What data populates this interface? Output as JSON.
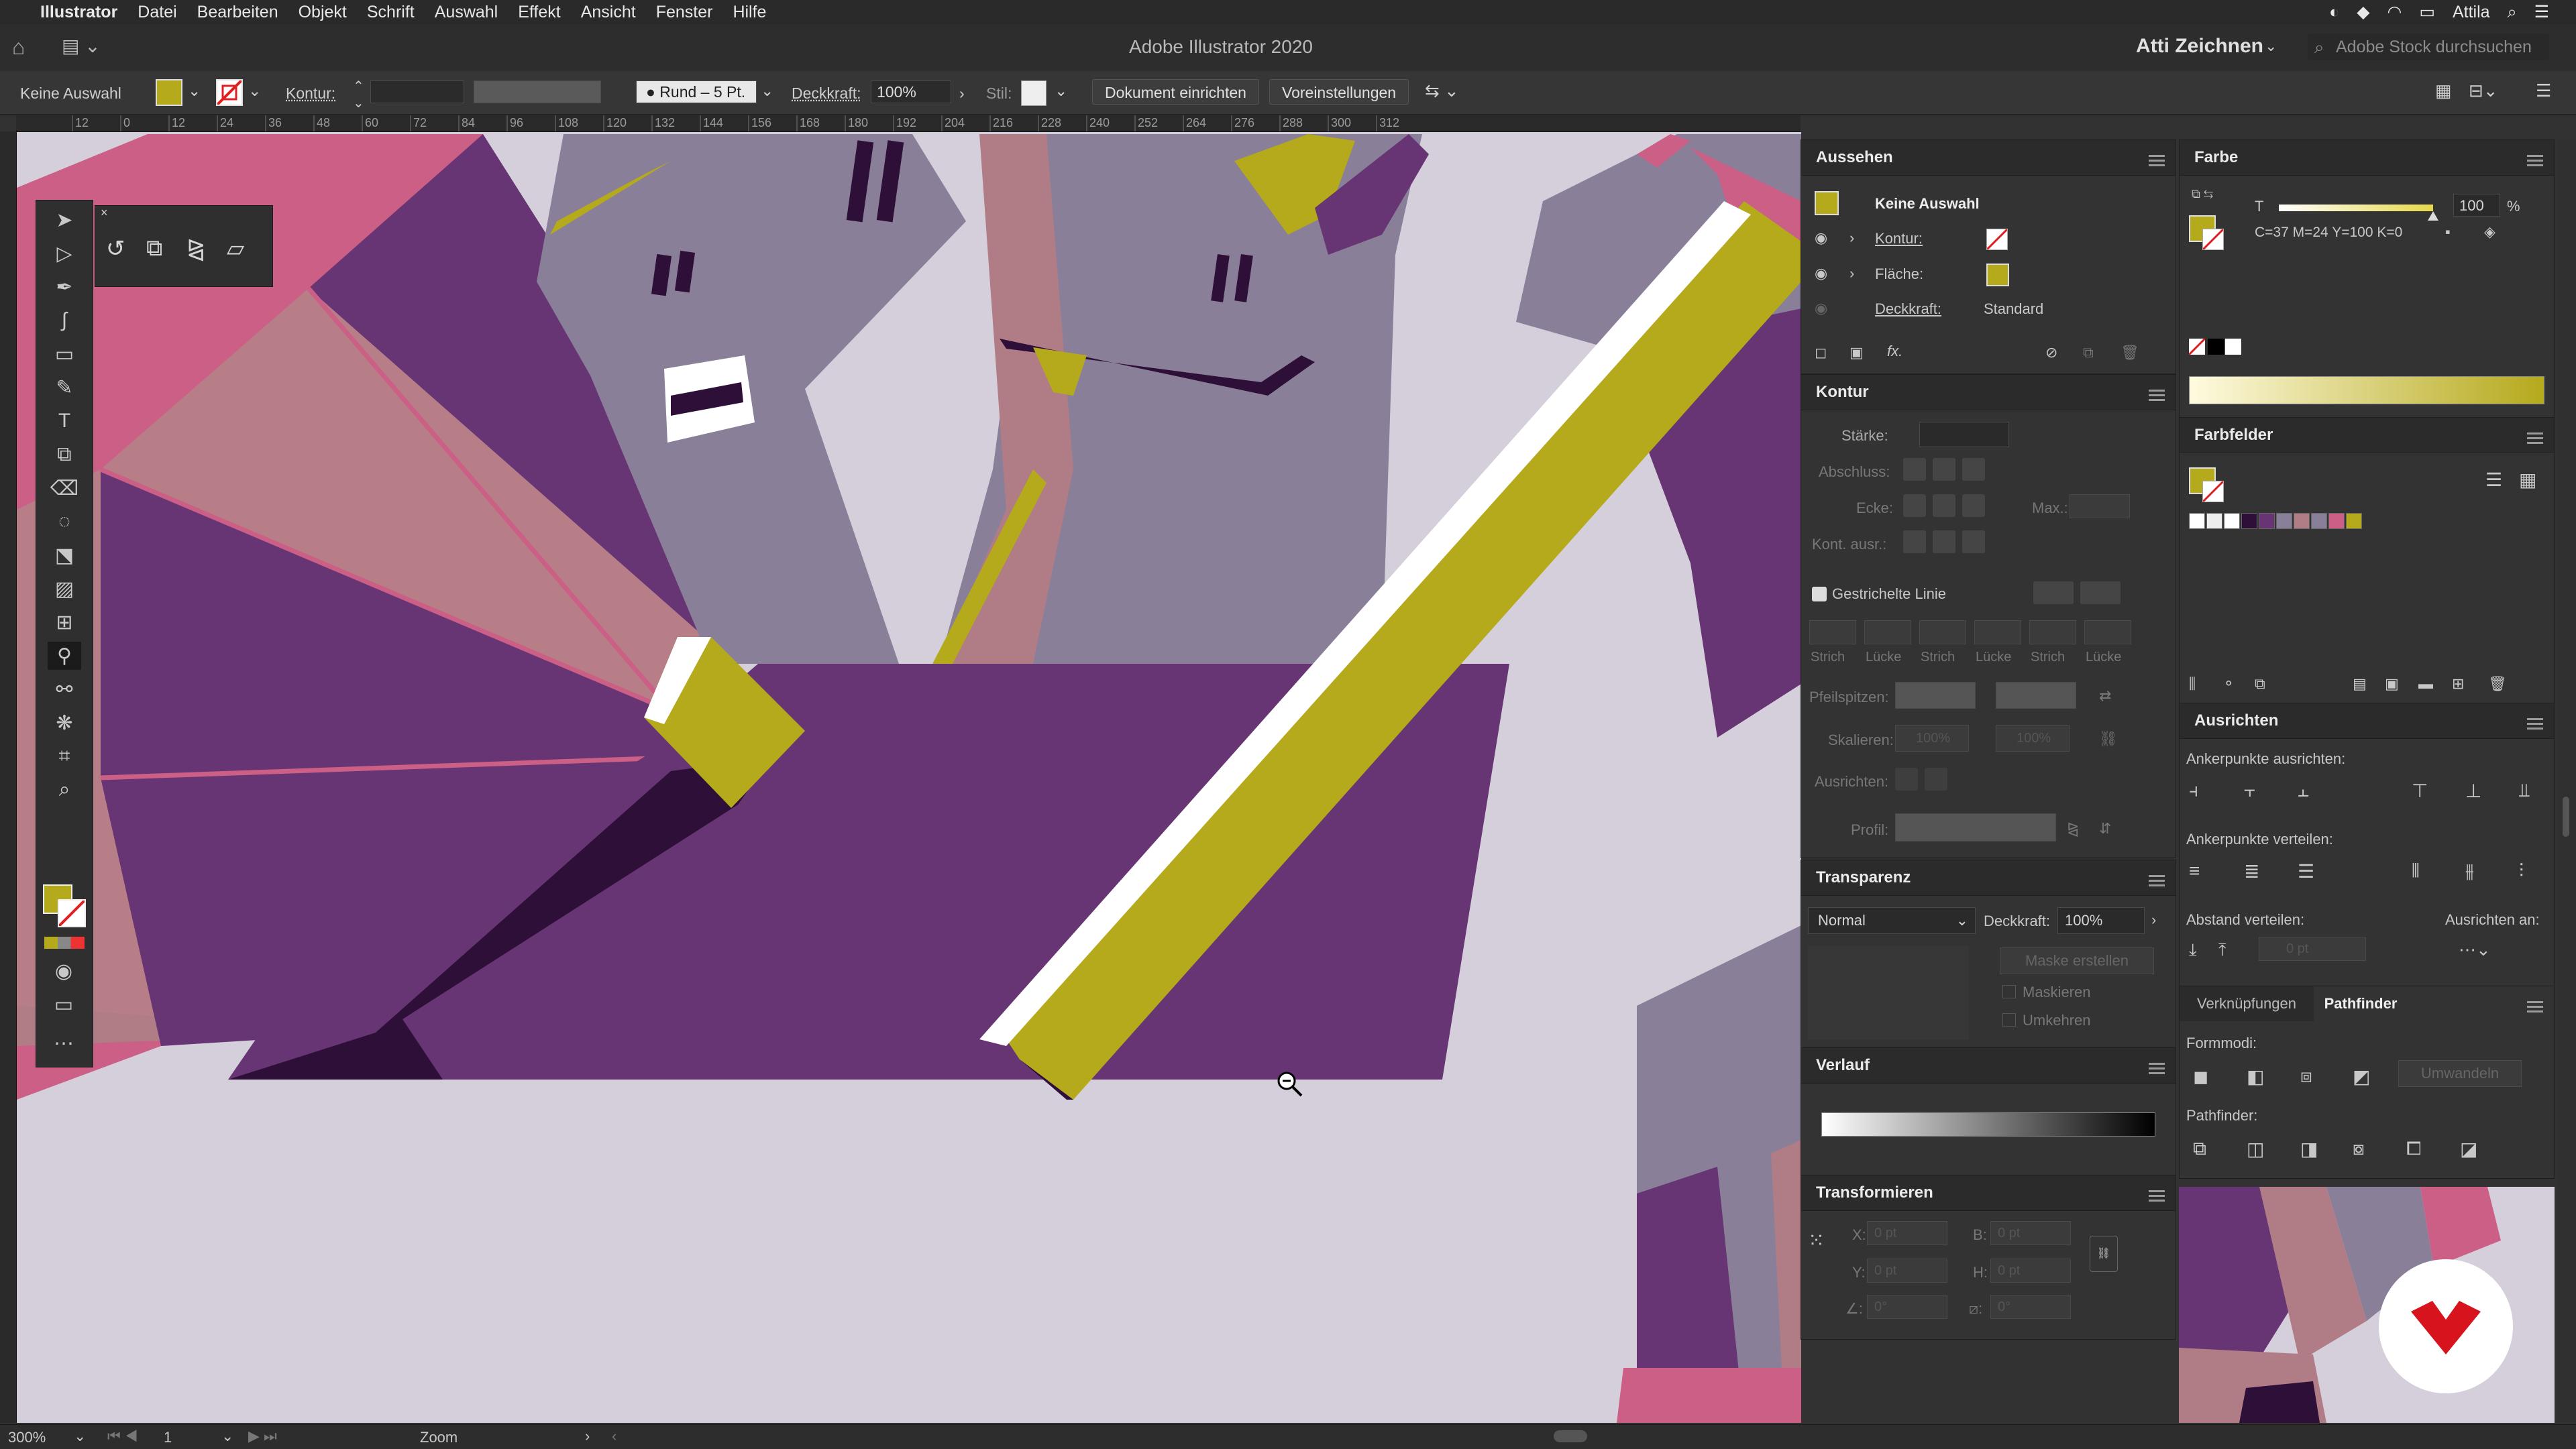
{
  "menubar": {
    "app": "Illustrator",
    "items": [
      "Datei",
      "Bearbeiten",
      "Objekt",
      "Schrift",
      "Auswahl",
      "Effekt",
      "Ansicht",
      "Fenster",
      "Hilfe"
    ],
    "user": "Attila"
  },
  "titlebar": {
    "title": "Adobe Illustrator 2020",
    "workspace": "Atti Zeichnen",
    "stock_placeholder": "Adobe Stock durchsuchen"
  },
  "control": {
    "selection": "Keine Auswahl",
    "kontur": "Kontur:",
    "brush": "Rund – 5 Pt.",
    "deckkraft_label": "Deckkraft:",
    "deckkraft": "100%",
    "stil": "Stil:",
    "doc_setup": "Dokument einrichten",
    "prefs": "Voreinstellungen"
  },
  "ruler": [
    "12",
    "0",
    "12",
    "24",
    "36",
    "48",
    "60",
    "72",
    "84",
    "96",
    "108",
    "120",
    "132",
    "144",
    "156",
    "168",
    "180",
    "192",
    "204",
    "216",
    "228",
    "240",
    "252",
    "264",
    "276",
    "288",
    "300",
    "312"
  ],
  "aussehen": {
    "title": "Aussehen",
    "header": "Keine Auswahl",
    "kontur": "Kontur:",
    "flaeche": "Fläche:",
    "deckkraft": "Deckkraft:",
    "deckkraft_value": "Standard"
  },
  "kontur_panel": {
    "title": "Kontur",
    "staerke": "Stärke:",
    "abschluss": "Abschluss:",
    "ecke": "Ecke:",
    "max": "Max.:",
    "ausr": "Kont. ausr.:",
    "gestrichelte": "Gestrichelte Linie",
    "dash_labels": [
      "Strich",
      "Lücke",
      "Strich",
      "Lücke",
      "Strich",
      "Lücke"
    ],
    "pfeilspitzen": "Pfeilspitzen:",
    "skalieren": "Skalieren:",
    "skal_a": "100%",
    "skal_b": "100%",
    "ausrichten": "Ausrichten:",
    "profil": "Profil:"
  },
  "transparenz": {
    "title": "Transparenz",
    "mode": "Normal",
    "deckkraft_label": "Deckkraft:",
    "deckkraft": "100%",
    "maske": "Maske erstellen",
    "maskieren": "Maskieren",
    "umkehren": "Umkehren"
  },
  "verlauf": {
    "title": "Verlauf"
  },
  "transformieren": {
    "title": "Transformieren",
    "x": "X:",
    "y": "Y:",
    "b": "B:",
    "h": "H:",
    "xv": "0 pt",
    "yv": "0 pt",
    "bv": "0 pt",
    "hv": "0 pt",
    "angle": "0°",
    "shear": "0°"
  },
  "farbe": {
    "title": "Farbe",
    "t_label": "T",
    "t_value": "100",
    "percent": "%",
    "cmyk": "C=37 M=24 Y=100 K=0"
  },
  "farbfelder": {
    "title": "Farbfelder"
  },
  "ausrichten": {
    "title": "Ausrichten",
    "anker_ausrichten": "Ankerpunkte ausrichten:",
    "anker_verteilen": "Ankerpunkte verteilen:",
    "abstand": "Abstand verteilen:",
    "ausrichten_an": "Ausrichten an:",
    "abstand_value": "0 pt"
  },
  "pathfinder": {
    "tab1": "Verknüpfungen",
    "tab2": "Pathfinder",
    "formmodi": "Formmodi:",
    "umwandeln": "Umwandeln",
    "pathfinder_label": "Pathfinder:"
  },
  "status": {
    "zoom": "300%",
    "artboard": "1",
    "tool": "Zoom"
  },
  "colors": {
    "accent_yellow": "#b5a91c",
    "purple": "#673573",
    "pink": "#cc5f85",
    "slate": "#8a7f99",
    "canvas": "#d5cfdb"
  }
}
